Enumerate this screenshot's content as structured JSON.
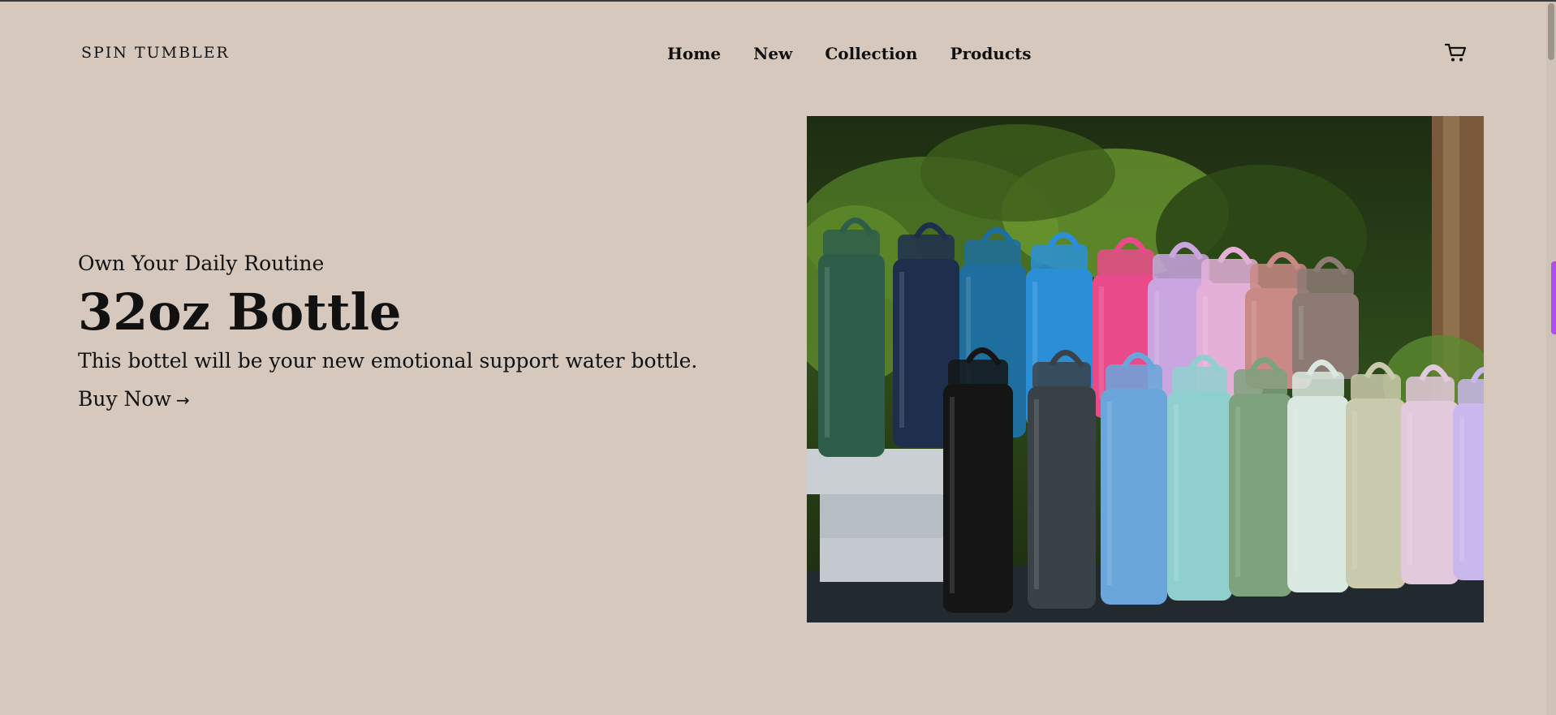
{
  "nav": {
    "brand": "SPIN TUMBLER",
    "links": [
      "Home",
      "New",
      "Collection",
      "Products"
    ],
    "cart_icon": "cart-icon"
  },
  "hero": {
    "eyebrow": "Own Your Daily Routine",
    "title": "32oz Bottle",
    "description": "This bottel will be your new emotional support water bottle.",
    "cta": "Buy Now",
    "cta_icon": "arrow-right-icon"
  },
  "colors": {
    "background": "#d6c8bc",
    "text": "#111111",
    "accent": "#b24cf0"
  }
}
